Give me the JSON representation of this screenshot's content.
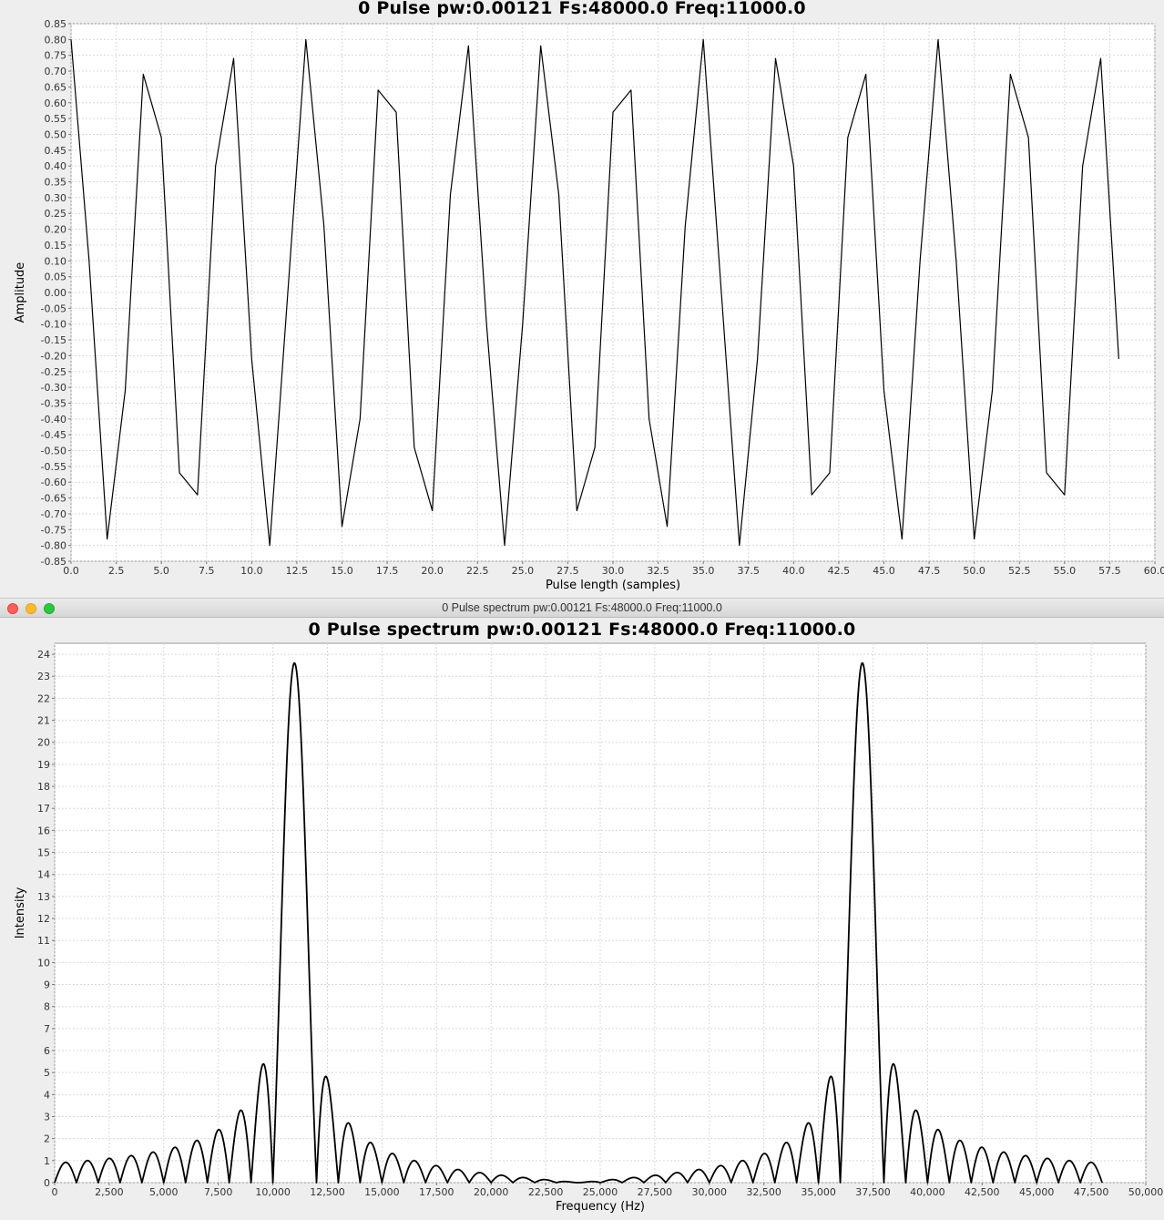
{
  "window2": {
    "title": "0 Pulse spectrum pw:0.00121 Fs:48000.0 Freq:11000.0",
    "controls": {
      "close": "close-icon",
      "minimize": "minimize-icon",
      "zoom": "zoom-icon"
    },
    "control_colors": {
      "close": "#fc5f57",
      "minimize": "#fdbc2e",
      "zoom": "#29c840"
    }
  },
  "chart_data": [
    {
      "type": "line",
      "title": "0 Pulse pw:0.00121 Fs:48000.0 Freq:11000.0",
      "xlabel": "Pulse length (samples)",
      "ylabel": "Amplitude",
      "xlim": [
        0,
        60
      ],
      "ylim": [
        -0.85,
        0.85
      ],
      "xticks": [
        "0.0",
        "2.5",
        "5.0",
        "7.5",
        "10.0",
        "12.5",
        "15.0",
        "17.5",
        "20.0",
        "22.5",
        "25.0",
        "27.5",
        "30.0",
        "32.5",
        "35.0",
        "37.5",
        "40.0",
        "42.5",
        "45.0",
        "47.5",
        "50.0",
        "52.5",
        "55.0",
        "57.5",
        "60.0"
      ],
      "yticks": [
        "0.85",
        "0.80",
        "0.75",
        "0.70",
        "0.65",
        "0.60",
        "0.55",
        "0.50",
        "0.45",
        "0.40",
        "0.35",
        "0.30",
        "0.25",
        "0.20",
        "0.15",
        "0.10",
        "0.05",
        "0.00",
        "-0.05",
        "-0.10",
        "-0.15",
        "-0.20",
        "-0.25",
        "-0.30",
        "-0.35",
        "-0.40",
        "-0.45",
        "-0.50",
        "-0.55",
        "-0.60",
        "-0.65",
        "-0.70",
        "-0.75",
        "-0.80",
        "-0.85"
      ],
      "grid": true,
      "series": [
        {
          "color": "#000000",
          "x": [
            0,
            1,
            2,
            3,
            4,
            5,
            6,
            7,
            8,
            9,
            10,
            11,
            12,
            13,
            14,
            15,
            16,
            17,
            18,
            19,
            20,
            21,
            22,
            23,
            24,
            25,
            26,
            27,
            28,
            29,
            30,
            31,
            32,
            33,
            34,
            35,
            36,
            37,
            38,
            39,
            40,
            41,
            42,
            43,
            44,
            45,
            46,
            47,
            48,
            49,
            50,
            51,
            52,
            53,
            54,
            55,
            56,
            57,
            58
          ],
          "values": [
            0.8,
            0.1,
            -0.78,
            -0.31,
            0.69,
            0.49,
            -0.57,
            -0.64,
            0.4,
            0.74,
            -0.21,
            -0.8,
            0.0,
            0.8,
            0.21,
            -0.74,
            -0.4,
            0.64,
            0.57,
            -0.49,
            -0.69,
            0.31,
            0.78,
            -0.1,
            -0.8,
            -0.1,
            0.78,
            0.31,
            -0.69,
            -0.49,
            0.57,
            0.64,
            -0.4,
            -0.74,
            0.21,
            0.8,
            0.0,
            -0.8,
            -0.21,
            0.74,
            0.4,
            -0.64,
            -0.57,
            0.49,
            0.69,
            -0.31,
            -0.78,
            0.1,
            0.8,
            0.1,
            -0.78,
            -0.31,
            0.69,
            0.49,
            -0.57,
            -0.64,
            0.4,
            0.74,
            -0.21
          ]
        }
      ]
    },
    {
      "type": "line",
      "title": "0 Pulse spectrum pw:0.00121 Fs:48000.0 Freq:11000.0",
      "xlabel": "Frequency (Hz)",
      "ylabel": "Intensity",
      "xlim": [
        0,
        50000
      ],
      "ylim": [
        0,
        24.5
      ],
      "xticks": [
        "0",
        "2,500",
        "5,000",
        "7,500",
        "10,000",
        "12,500",
        "15,000",
        "17,500",
        "20,000",
        "22,500",
        "25,000",
        "27,500",
        "30,000",
        "32,500",
        "35,000",
        "37,500",
        "40,000",
        "42,500",
        "45,000",
        "47,500",
        "50,000"
      ],
      "yticks": [
        "0",
        "1",
        "2",
        "3",
        "4",
        "5",
        "6",
        "7",
        "8",
        "9",
        "10",
        "11",
        "12",
        "13",
        "14",
        "15",
        "16",
        "17",
        "18",
        "19",
        "20",
        "21",
        "22",
        "23",
        "24"
      ],
      "grid": true,
      "series": [
        {
          "color": "#000000",
          "x_range": [
            0,
            48000
          ],
          "peaks_hz": [
            11000,
            37000
          ],
          "peak_value": 23.6,
          "first_sidelobe": 5.1,
          "floor_lobe": 0.75,
          "main_lobe_halfwidth_hz": 827,
          "sidelobe_spacing_hz": 1000
        }
      ]
    }
  ]
}
